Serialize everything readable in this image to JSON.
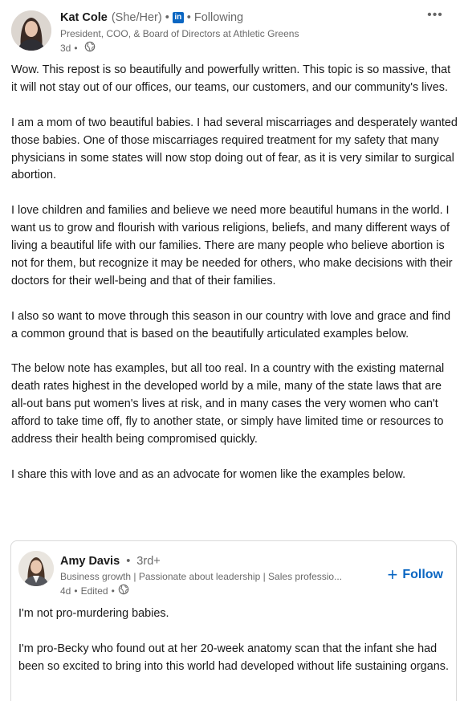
{
  "post": {
    "author": {
      "name": "Kat Cole",
      "pronouns": "(She/Her)",
      "badge": "in",
      "connection": "Following",
      "headline": "President, COO, & Board of Directors at Athletic Greens",
      "time": "3d",
      "visibility_icon": "globe-icon"
    },
    "more_icon": "•••",
    "paragraphs": [
      "Wow. This repost is so beautifully and powerfully written. This topic is so massive, that it will not stay out of our offices, our teams, our customers, and our community's lives.",
      "I am a mom of two beautiful babies. I had several miscarriages and desperately wanted those babies. One of those miscarriages required treatment for my safety that many physicians in some states will now stop doing out of fear, as it is very similar to surgical abortion.",
      "I love children and families and believe we need more beautiful humans in the world. I want us to grow and flourish with various religions, beliefs, and many different ways of living a beautiful life with our families. There are many people who believe abortion is not for them, but recognize it may be needed for others, who make decisions with their doctors for their well-being and that of their families.",
      "I also so want to move through this season in our country with love and grace and find a common ground that is based on the beautifully articulated examples below.",
      "The below note has examples, but all too real. In a country with the existing maternal death rates highest in the developed world by a mile, many of the state laws that are all-out bans put women's lives at risk, and in many cases the very women who can't afford to take time off, fly to another state, or simply have limited time or resources to address their health being compromised quickly.",
      "I share this with love and as an advocate for women like the examples below."
    ]
  },
  "reshared": {
    "author": {
      "name": "Amy Davis",
      "degree": "3rd+",
      "headline": "Business growth | Passionate about leadership | Sales professio...",
      "time": "4d",
      "edited": "Edited",
      "visibility_icon": "globe-icon"
    },
    "follow_plus": "+",
    "follow_label": "Follow",
    "paragraphs": [
      "I'm not pro-murdering babies.",
      "I'm pro-Becky who found out at her 20-week anatomy scan that the infant she had been so excited to bring into this world had developed without life sustaining organs."
    ]
  },
  "colors": {
    "accent": "#0a66c2",
    "text": "rgba(0,0,0,0.9)",
    "secondary": "rgba(0,0,0,0.6)",
    "border": "#d9d9d9"
  }
}
